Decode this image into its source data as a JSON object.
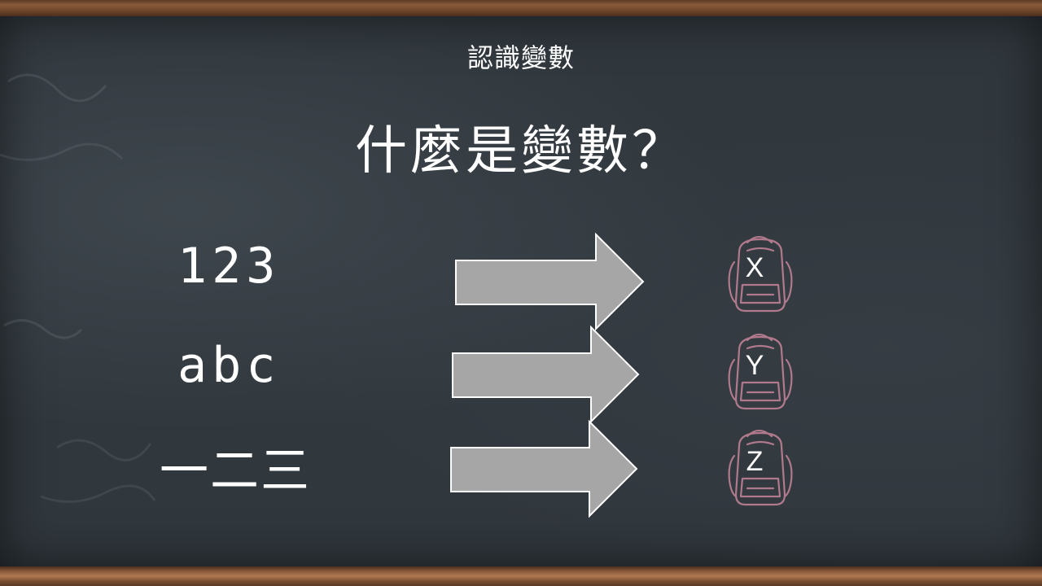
{
  "header": {
    "subtitle": "認識變數"
  },
  "main": {
    "title": "什麼是變數？",
    "values": [
      "123",
      "abc",
      "一二三"
    ],
    "variables": [
      "X",
      "Y",
      "Z"
    ]
  },
  "colors": {
    "board": "#30373d",
    "frame": "#8a5a3a",
    "arrow_fill": "#a6a6a6",
    "arrow_stroke": "#ffffff",
    "bag_stroke": "#b07a8c"
  },
  "icons": {
    "arrow": "right-arrow-icon",
    "bag": "backpack-icon"
  }
}
